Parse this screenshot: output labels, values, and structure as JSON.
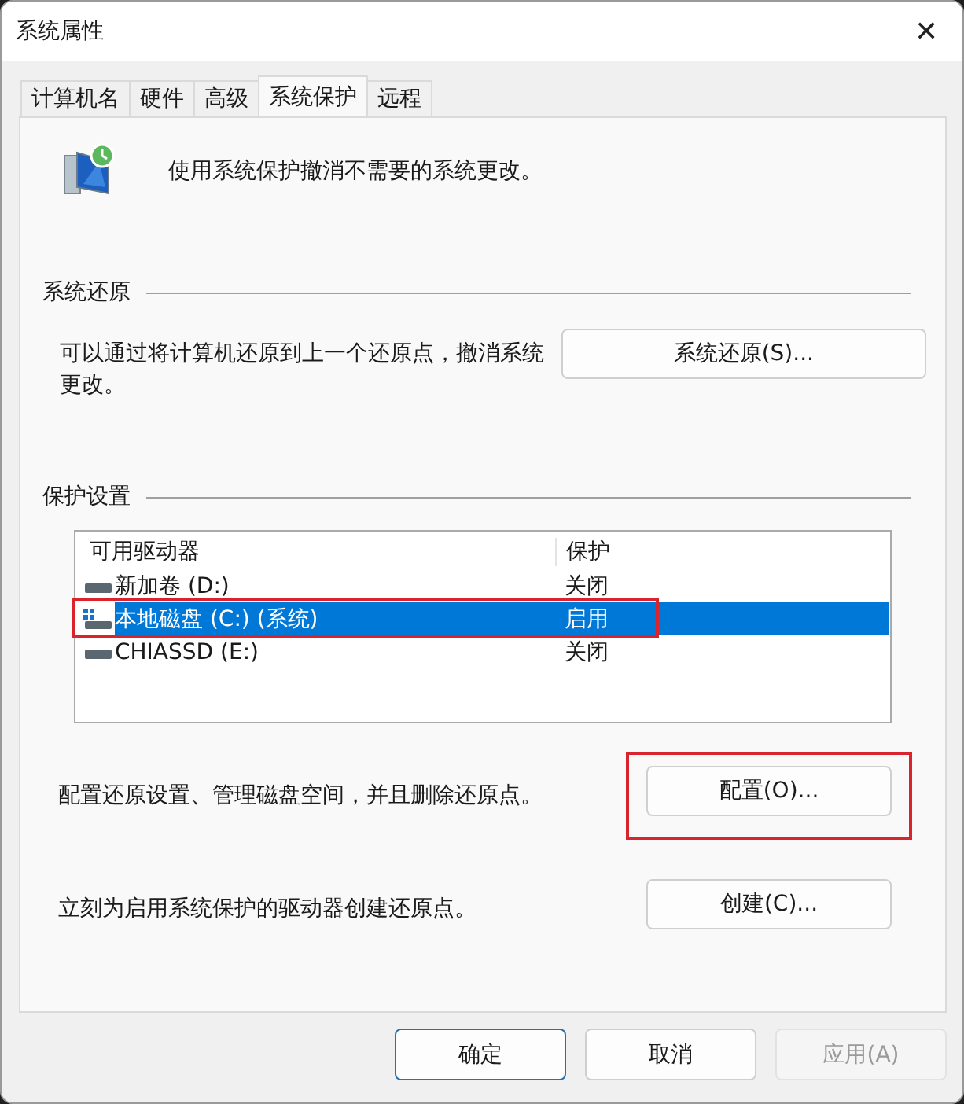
{
  "window": {
    "title": "系统属性",
    "close": "✕"
  },
  "tabs": [
    {
      "label": "计算机名",
      "selected": false
    },
    {
      "label": "硬件",
      "selected": false
    },
    {
      "label": "高级",
      "selected": false
    },
    {
      "label": "系统保护",
      "selected": true
    },
    {
      "label": "远程",
      "selected": false
    }
  ],
  "intro": "使用系统保护撤消不需要的系统更改。",
  "restore": {
    "heading": "系统还原",
    "text": "可以通过将计算机还原到上一个还原点，撤消系统更改。",
    "button": "系统还原(S)..."
  },
  "protection": {
    "heading": "保护设置",
    "columns": [
      "可用驱动器",
      "保护"
    ],
    "drives": [
      {
        "name": "新加卷 (D:)",
        "status": "关闭",
        "kind": "disk",
        "selected": false,
        "highlighted": false
      },
      {
        "name": "本地磁盘 (C:) (系统)",
        "status": "启用",
        "kind": "system",
        "selected": true,
        "highlighted": true
      },
      {
        "name": "CHIASSD (E:)",
        "status": "关闭",
        "kind": "disk",
        "selected": false,
        "highlighted": false
      }
    ],
    "actions": [
      {
        "text": "配置还原设置、管理磁盘空间，并且删除还原点。",
        "button": "配置(O)...",
        "highlighted": true
      },
      {
        "text": "立刻为启用系统保护的驱动器创建还原点。",
        "button": "创建(C)...",
        "highlighted": false
      }
    ]
  },
  "buttons": [
    {
      "label": "确定",
      "default": true,
      "disabled": false
    },
    {
      "label": "取消",
      "default": false,
      "disabled": false
    },
    {
      "label": "应用(A)",
      "default": false,
      "disabled": true
    }
  ]
}
